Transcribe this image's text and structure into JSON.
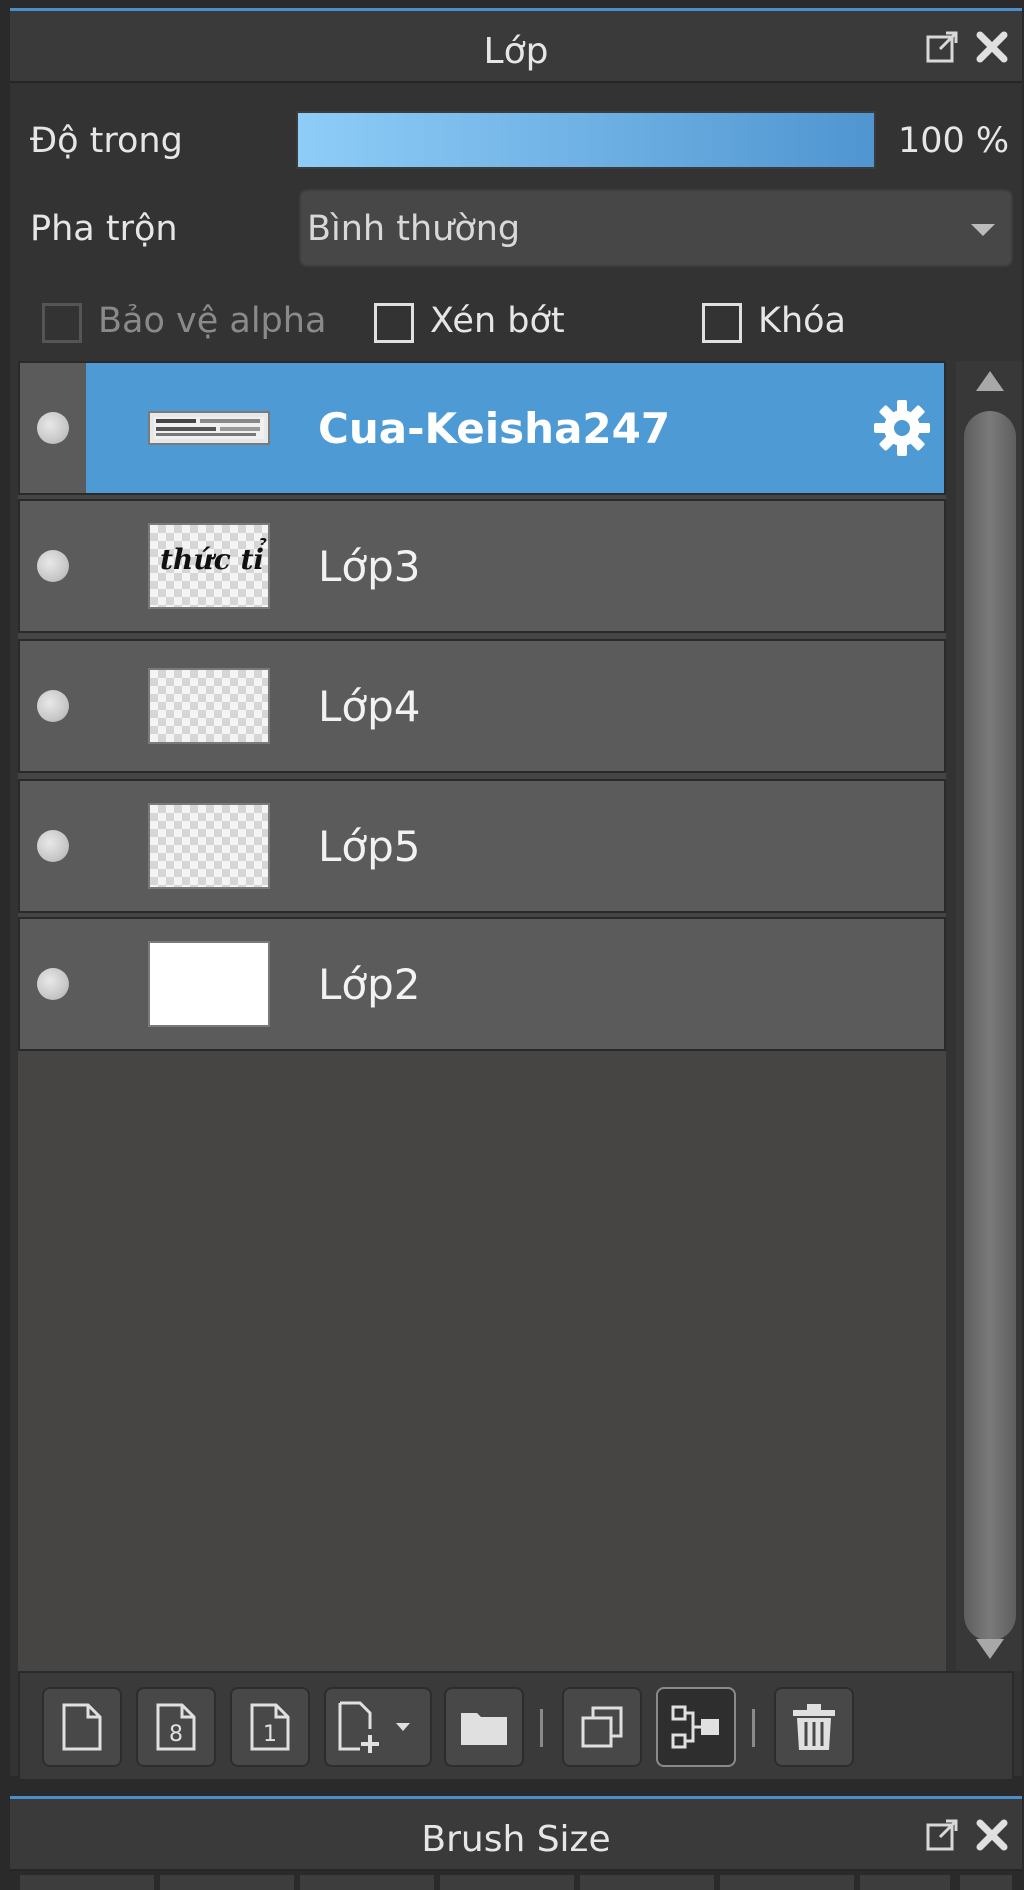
{
  "panel": {
    "title": "Lớp"
  },
  "opacity": {
    "label": "Độ trong",
    "value": "100 %",
    "fraction": 1.0
  },
  "blend": {
    "label": "Pha trộn",
    "value": "Bình thường"
  },
  "options": {
    "protect_alpha": "Bảo vệ alpha",
    "clip": "Xén bớt",
    "lock": "Khóa"
  },
  "layers": [
    {
      "name": "Cua-Keisha247",
      "active": true
    },
    {
      "name": "Lớp3",
      "thumb_text": "thức tỉ"
    },
    {
      "name": "Lớp4"
    },
    {
      "name": "Lớp5"
    },
    {
      "name": "Lớp2"
    }
  ],
  "toolbar": {
    "icons": [
      "new-layer-icon",
      "new-8bit-layer-icon",
      "new-1bit-layer-icon",
      "add-layer-menu-icon",
      "folder-icon",
      "duplicate-icon",
      "merge-down-icon",
      "trash-icon"
    ]
  },
  "panel2": {
    "title": "Brush Size"
  },
  "colors": {
    "accent": "#4e9ad4",
    "panel_bg": "#333333",
    "row_bg": "#5b5b5b"
  }
}
